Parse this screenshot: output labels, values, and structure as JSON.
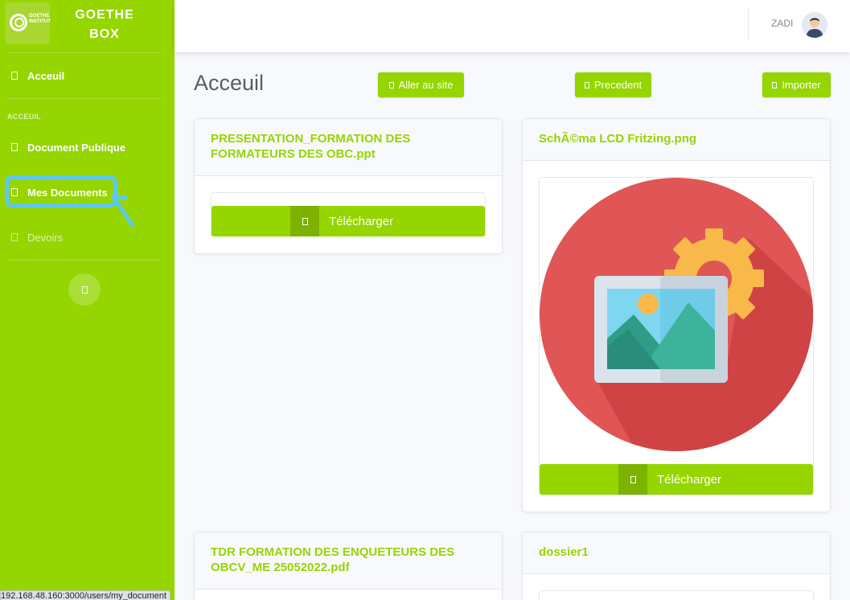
{
  "brand": {
    "name_line1": "GOETHE",
    "name_line2": "BOX",
    "logo_text": "GOETHE INSTITUT"
  },
  "sidebar": {
    "items": [
      {
        "label": "Acceuil",
        "icon": "home-icon"
      },
      {
        "label": "Document Publique",
        "icon": "folder-icon"
      },
      {
        "label": "Mes Documents",
        "icon": "folder-icon"
      },
      {
        "label": "Devoirs",
        "icon": "tasks-icon"
      }
    ],
    "section_heading": "ACCEUIL",
    "toggle_icon": "chevron-left-icon"
  },
  "topbar": {
    "user_name": "ZADI"
  },
  "page": {
    "title": "Acceuil",
    "buttons": {
      "site": "Aller au site",
      "prev": "Precedent",
      "import": "Importer"
    }
  },
  "cards": [
    {
      "title": "PRESENTATION_FORMATION DES FORMATEURS DES OBC.ppt",
      "download": "Télécharger"
    },
    {
      "title": "SchÃ©ma LCD Fritzing.png",
      "download": "Télécharger"
    },
    {
      "title": "TDR FORMATION DES ENQUETEURS DES OBCV_ME 25052022.pdf"
    },
    {
      "title": "dossier1"
    }
  ],
  "status_url": "192.168.48.160:3000/users/my_document",
  "colors": {
    "accent": "#95d500",
    "accent_dark": "#7cb200",
    "annotation": "#5ec8ee"
  }
}
